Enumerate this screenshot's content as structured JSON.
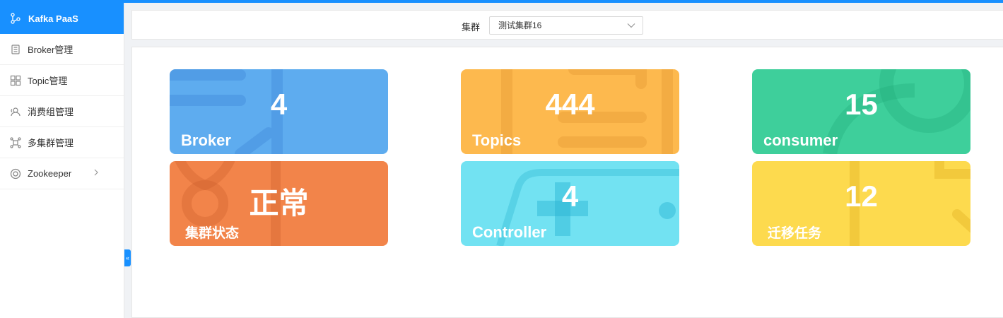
{
  "sidebar": {
    "brand": "Kafka PaaS",
    "items": [
      {
        "label": "Broker管理",
        "icon": "server-icon"
      },
      {
        "label": "Topic管理",
        "icon": "grid-icon"
      },
      {
        "label": "消费组管理",
        "icon": "users-icon"
      },
      {
        "label": "多集群管理",
        "icon": "cluster-icon"
      },
      {
        "label": "Zookeeper",
        "icon": "lifebuoy-icon"
      }
    ],
    "collapse_glyph": "«"
  },
  "header": {
    "cluster_label": "集群",
    "cluster_value": "测试集群16"
  },
  "cards": [
    {
      "value": "4",
      "label": "Broker",
      "color": "#5eacef"
    },
    {
      "value": "444",
      "label": "Topics",
      "color": "#fdb94e"
    },
    {
      "value": "15",
      "label": "consumer",
      "color": "#3ecf9b"
    },
    {
      "value": "正常",
      "label": "集群状态",
      "color": "#f2844a"
    },
    {
      "value": "4",
      "label": "Controller",
      "color": "#72e2f2"
    },
    {
      "value": "12",
      "label": "迁移任务",
      "color": "#fdda4e"
    }
  ]
}
